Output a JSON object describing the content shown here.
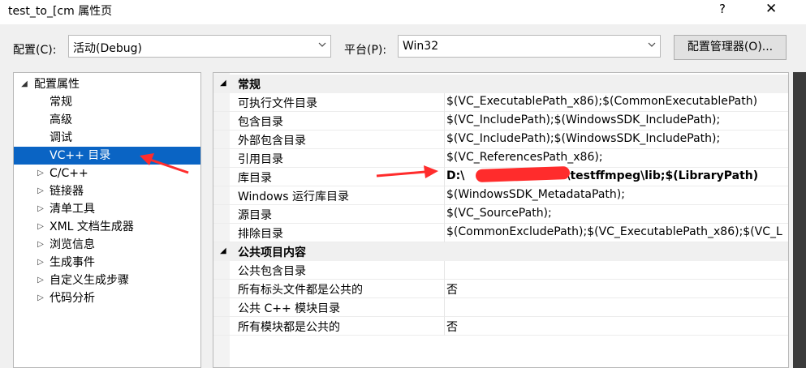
{
  "window": {
    "title": "test_to_[cm 属性页",
    "help": "?",
    "close": "✕"
  },
  "toolbar": {
    "config_label": "配置(C):",
    "config_value": "活动(Debug)",
    "platform_label": "平台(P):",
    "platform_value": "Win32",
    "config_manager": "配置管理器(O)..."
  },
  "tree": {
    "items": [
      {
        "label": "配置属性",
        "expander": "◢"
      },
      {
        "label": "常规",
        "expander": ""
      },
      {
        "label": "高级",
        "expander": ""
      },
      {
        "label": "调试",
        "expander": ""
      },
      {
        "label": "VC++ 目录",
        "expander": ""
      },
      {
        "label": "C/C++",
        "expander": "▷"
      },
      {
        "label": "链接器",
        "expander": "▷"
      },
      {
        "label": "清单工具",
        "expander": "▷"
      },
      {
        "label": "XML 文档生成器",
        "expander": "▷"
      },
      {
        "label": "浏览信息",
        "expander": "▷"
      },
      {
        "label": "生成事件",
        "expander": "▷"
      },
      {
        "label": "自定义生成步骤",
        "expander": "▷"
      },
      {
        "label": "代码分析",
        "expander": "▷"
      }
    ]
  },
  "grid": {
    "cat_general": {
      "label": "常规",
      "toggle": "◢"
    },
    "rows_general": [
      {
        "name": "可执行文件目录",
        "value": "$(VC_ExecutablePath_x86);$(CommonExecutablePath)"
      },
      {
        "name": "包含目录",
        "value": "$(VC_IncludePath);$(WindowsSDK_IncludePath);"
      },
      {
        "name": "外部包含目录",
        "value": "$(VC_IncludePath);$(WindowsSDK_IncludePath);"
      },
      {
        "name": "引用目录",
        "value": "$(VC_ReferencesPath_x86);"
      },
      {
        "name": "库目录",
        "value_prefix": "D:\\",
        "value_suffix": "\\testffmpeg\\lib;$(LibraryPath)"
      },
      {
        "name": "Windows 运行库目录",
        "value": "$(WindowsSDK_MetadataPath);"
      },
      {
        "name": "源目录",
        "value": "$(VC_SourcePath);"
      },
      {
        "name": "排除目录",
        "value": "$(CommonExcludePath);$(VC_ExecutablePath_x86);$(VC_L"
      }
    ],
    "cat_public": {
      "label": "公共项目内容",
      "toggle": "◢"
    },
    "rows_public": [
      {
        "name": "公共包含目录",
        "value": ""
      },
      {
        "name": "所有标头文件都是公共的",
        "value": "否"
      },
      {
        "name": "公共 C++ 模块目录",
        "value": ""
      },
      {
        "name": "所有模块都是公共的",
        "value": "否"
      }
    ]
  },
  "colors": {
    "selection": "#0a64c4",
    "annotation": "#ff2c2c"
  }
}
